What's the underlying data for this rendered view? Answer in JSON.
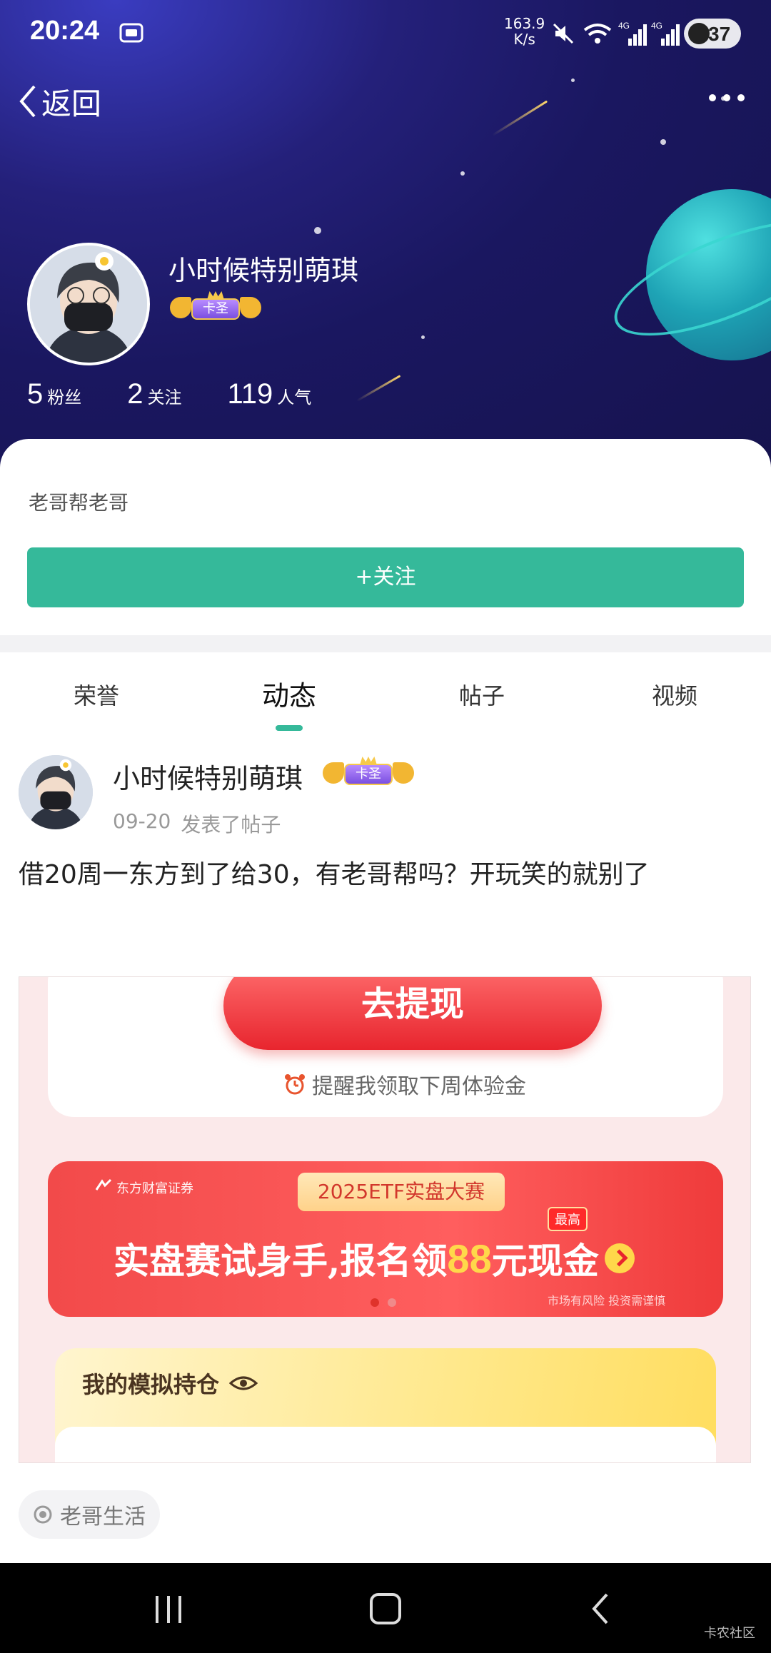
{
  "status_bar": {
    "time": "20:24",
    "net_speed_value": "163.9",
    "net_speed_unit": "K/s",
    "net_type_1": "4G",
    "net_type_2": "4G",
    "battery": "37"
  },
  "nav": {
    "back_label": "返回"
  },
  "profile": {
    "name": "小时候特别萌琪",
    "badge": "卡圣",
    "stats": [
      {
        "value": "5",
        "label": "粉丝"
      },
      {
        "value": "2",
        "label": "关注"
      },
      {
        "value": "119",
        "label": "人气"
      }
    ],
    "bio": "老哥帮老哥",
    "follow_label": "+关注"
  },
  "tabs": [
    {
      "label": "荣誉",
      "active": false
    },
    {
      "label": "动态",
      "active": true
    },
    {
      "label": "帖子",
      "active": false
    },
    {
      "label": "视频",
      "active": false
    }
  ],
  "post": {
    "author": "小时候特别萌琪",
    "badge": "卡圣",
    "date": "09-20",
    "action": "发表了帖子",
    "text": "借20周一东方到了给30，有老哥帮吗？开玩笑的就别了",
    "image": {
      "withdraw_button": "去提现",
      "reminder": "提醒我领取下周体验金",
      "banner_brand": "东方财富证券",
      "banner_tag": "2025ETF实盘大赛",
      "banner_max": "最高",
      "banner_main_prefix": "实盘赛试身手,报名领",
      "banner_main_highlight": "88",
      "banner_main_suffix": "元现金",
      "banner_risk": "市场有风险 投资需谨慎",
      "holding_title": "我的模拟持仓"
    }
  },
  "topic_tag": "老哥生活",
  "watermark": "卡农社区",
  "colors": {
    "accent": "#35b99a",
    "header_bg": "#1a1760"
  }
}
